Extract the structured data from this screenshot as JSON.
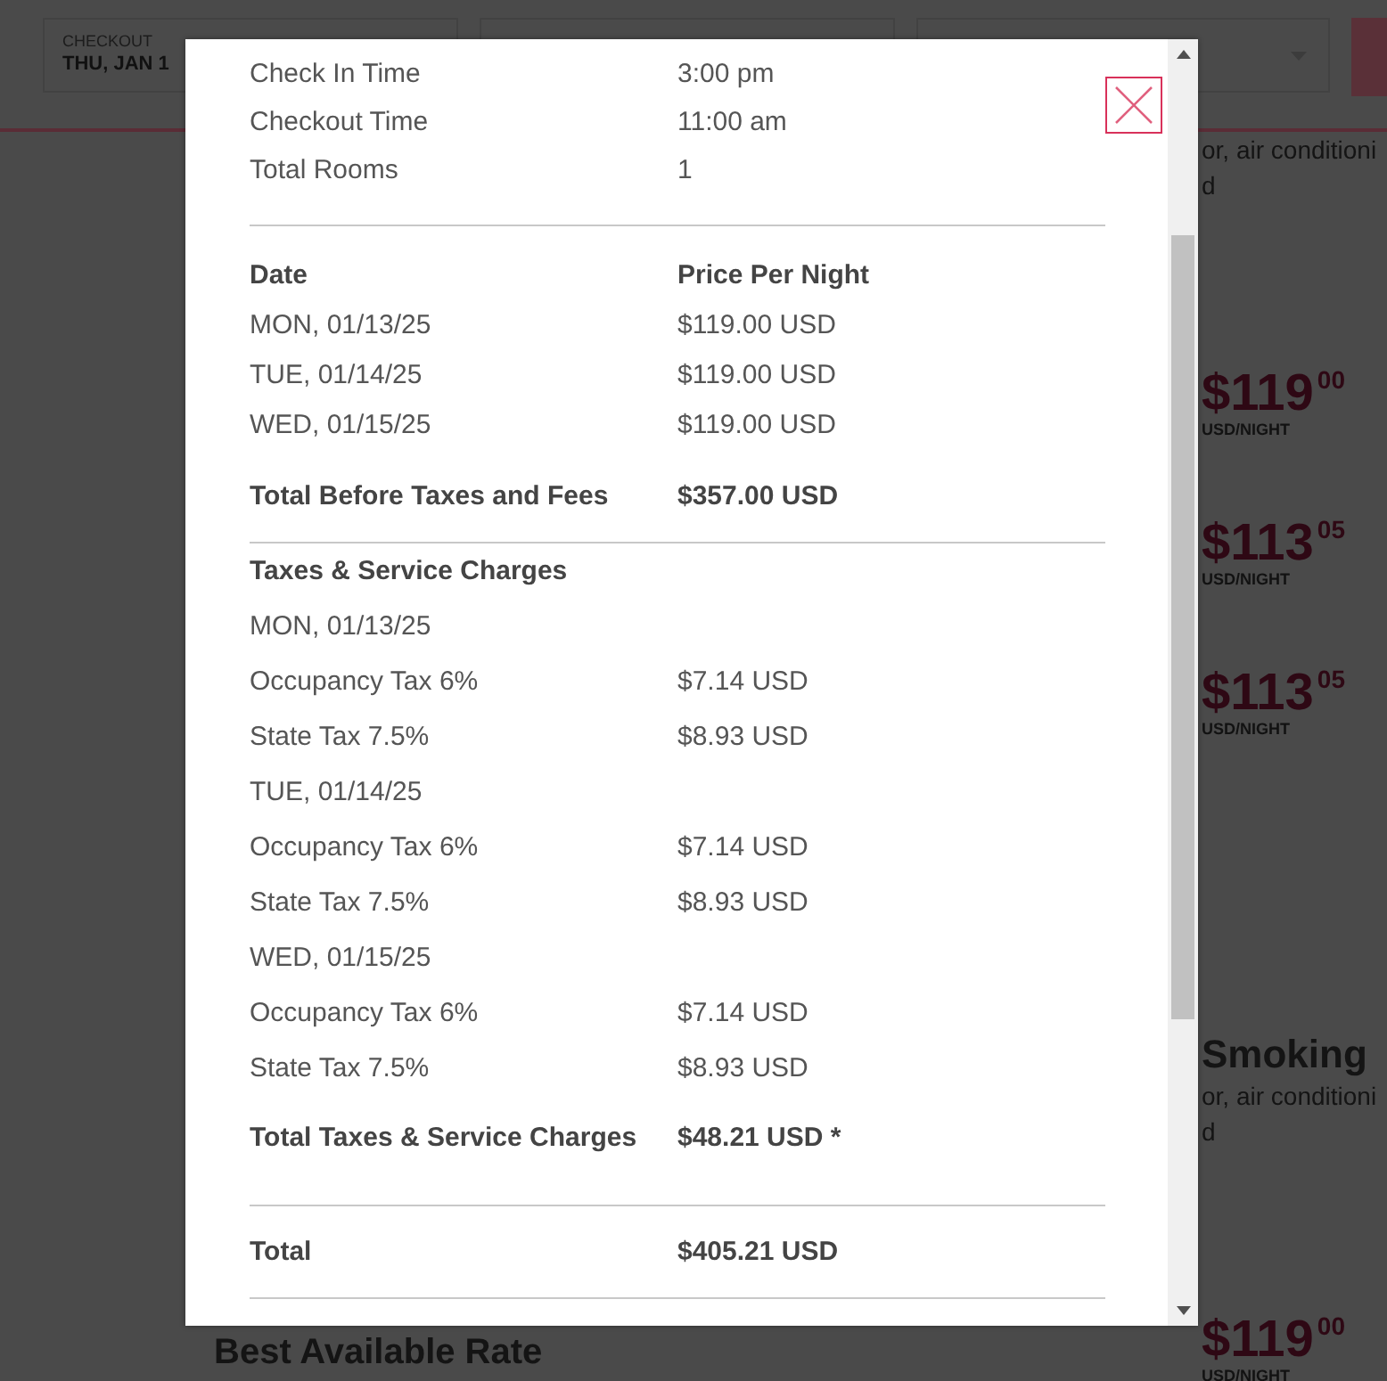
{
  "background": {
    "checkout_label": "CHECKOUT",
    "checkout_value": "THU, JAN 1",
    "blocks": [
      {
        "kind": "text",
        "text": "or, air conditioni"
      },
      {
        "kind": "text",
        "text": "d"
      },
      {
        "kind": "price",
        "amount": "$119",
        "cents": "00",
        "unit": "USD/NIGHT"
      },
      {
        "kind": "price",
        "amount": "$113",
        "cents": "05",
        "unit": "USD/NIGHT"
      },
      {
        "kind": "price",
        "amount": "$113",
        "cents": "05",
        "unit": "USD/NIGHT"
      },
      {
        "kind": "title",
        "text": "Smoking"
      },
      {
        "kind": "text",
        "text": "or, air conditioni"
      },
      {
        "kind": "text",
        "text": "d"
      },
      {
        "kind": "price",
        "amount": "$119",
        "cents": "00",
        "unit": "USD/NIGHT"
      }
    ],
    "rate_title": "Best Available Rate"
  },
  "modal": {
    "summary": [
      {
        "label": "Check In Time",
        "value": "3:00 pm"
      },
      {
        "label": "Checkout Time",
        "value": "11:00 am"
      },
      {
        "label": "Total Rooms",
        "value": "1"
      }
    ],
    "nightly": {
      "headers": [
        "Date",
        "Price Per Night"
      ],
      "rows": [
        {
          "date": "MON, 01/13/25",
          "price": "$119.00 USD"
        },
        {
          "date": "TUE, 01/14/25",
          "price": "$119.00 USD"
        },
        {
          "date": "WED, 01/15/25",
          "price": "$119.00 USD"
        }
      ],
      "total": {
        "label": "Total Before Taxes and Fees",
        "value": "$357.00 USD"
      }
    },
    "taxes": {
      "title": "Taxes & Service Charges",
      "days": [
        {
          "date": "MON, 01/13/25",
          "items": [
            {
              "label": "Occupancy Tax 6%",
              "value": "$7.14 USD"
            },
            {
              "label": "State Tax 7.5%",
              "value": "$8.93 USD"
            }
          ]
        },
        {
          "date": "TUE, 01/14/25",
          "items": [
            {
              "label": "Occupancy Tax 6%",
              "value": "$7.14 USD"
            },
            {
              "label": "State Tax 7.5%",
              "value": "$8.93 USD"
            }
          ]
        },
        {
          "date": "WED, 01/15/25",
          "items": [
            {
              "label": "Occupancy Tax 6%",
              "value": "$7.14 USD"
            },
            {
              "label": "State Tax 7.5%",
              "value": "$8.93 USD"
            }
          ]
        }
      ],
      "total": {
        "label": "Total Taxes & Service Charges",
        "value": "$48.21 USD *"
      }
    },
    "grand_total": {
      "label": "Total",
      "value": "$405.21 USD"
    }
  }
}
